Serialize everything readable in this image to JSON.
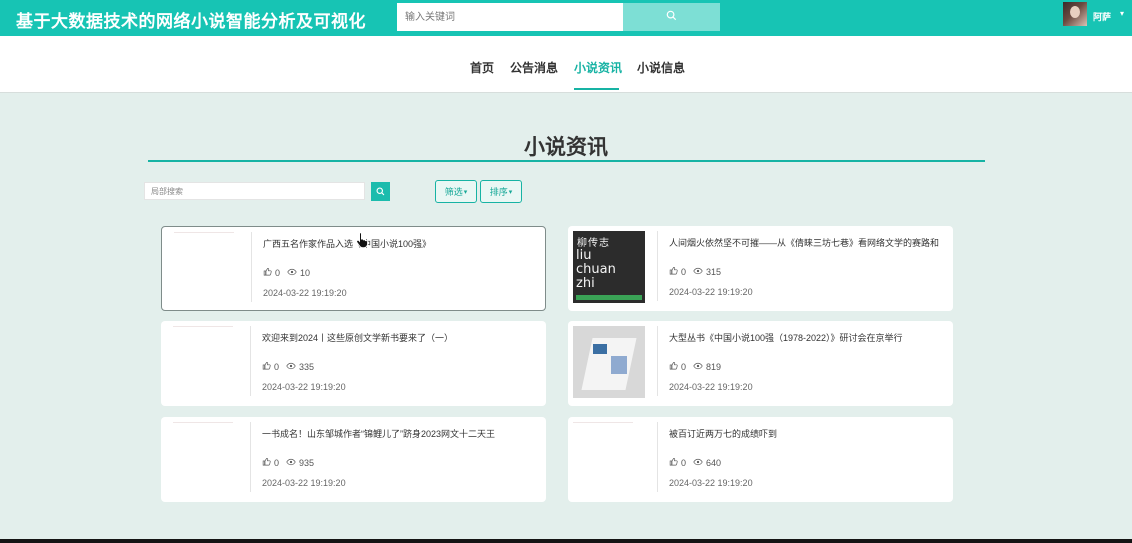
{
  "header": {
    "site_title": "基于大数据技术的网络小说智能分析及可视化",
    "search_placeholder": "输入关键词",
    "search_icon": "search-icon",
    "username": "阿萨",
    "user_caret": "▾"
  },
  "nav": {
    "items": [
      {
        "label": "首页"
      },
      {
        "label": "公告消息"
      },
      {
        "label": "小说资讯",
        "active": true
      },
      {
        "label": "小说信息"
      }
    ]
  },
  "main": {
    "title": "小说资讯",
    "local_search_placeholder": "局部搜索",
    "filter_label": "筛选",
    "sort_label": "排序",
    "caret": "▾"
  },
  "news": [
    {
      "title": "广西五名作家作品入选《中国小说100强》",
      "likes": "0",
      "views": "10",
      "date": "2024-03-22 19:19:20",
      "thumb": "blank"
    },
    {
      "title": "人间烟火依然坚不可摧——从《倩睐三坊七巷》看网络文学的赛路和",
      "likes": "0",
      "views": "315",
      "date": "2024-03-22 19:19:20",
      "thumb": "book-cover"
    },
    {
      "title": "欢迎来到2024丨这些原创文学新书要来了（一）",
      "likes": "0",
      "views": "335",
      "date": "2024-03-22 19:19:20",
      "thumb": "blank"
    },
    {
      "title": "大型丛书《中国小说100强（1978-2022）》研讨会在京举行",
      "likes": "0",
      "views": "819",
      "date": "2024-03-22 19:19:20",
      "thumb": "magazine"
    },
    {
      "title": "一书成名！山东邹城作者“锦鲤儿了”跻身2023网文十二天王",
      "likes": "0",
      "views": "935",
      "date": "2024-03-22 19:19:20",
      "thumb": "blank"
    },
    {
      "title": "被百订近两万七的成绩吓到",
      "likes": "0",
      "views": "640",
      "date": "2024-03-22 19:19:20",
      "thumb": "blank"
    }
  ],
  "book_cover": {
    "line1": "柳传志",
    "line2": "liu",
    "line3": "chuan",
    "line4": "zhi"
  },
  "colors": {
    "accent": "#17c4b4",
    "background": "#e3efec",
    "active_nav": "#17b3a4"
  }
}
